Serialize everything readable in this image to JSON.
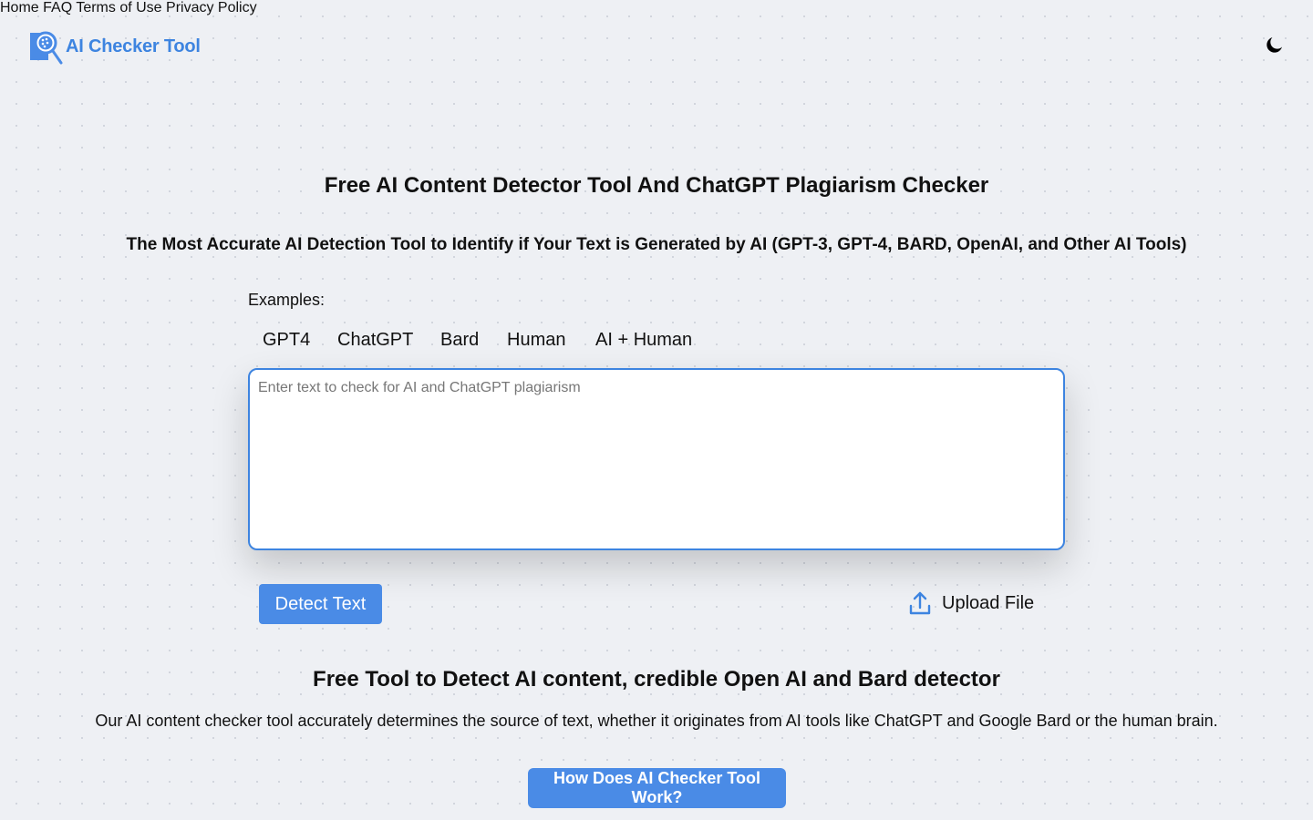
{
  "header": {
    "brand": "AI Checker Tool",
    "nav": [
      "Home",
      "FAQ",
      "Terms of Use",
      "Privacy Policy"
    ],
    "theme_toggle_icon": "moon-icon"
  },
  "hero": {
    "title": "Free AI Content Detector Tool And ChatGPT Plagiarism Checker",
    "subtitle": "The Most Accurate AI Detection Tool to Identify if Your Text is Generated by AI (GPT-3, GPT-4, BARD, OpenAI, and Other AI Tools)"
  },
  "examples": {
    "label": "Examples:",
    "items": [
      "GPT4",
      "ChatGPT",
      "Bard",
      "Human",
      "AI + Human"
    ]
  },
  "input": {
    "placeholder": "Enter text to check for AI and ChatGPT plagiarism",
    "value": ""
  },
  "actions": {
    "detect": "Detect Text",
    "upload": "Upload File",
    "upload_icon": "upload-icon"
  },
  "info": {
    "heading": "Free Tool to Detect AI content, credible Open AI and Bard detector",
    "description": "Our AI content checker tool accurately determines the source of text, whether it originates from AI tools like ChatGPT and Google Bard or the human brain.",
    "how_button": "How Does AI Checker Tool Work?"
  },
  "colors": {
    "accent": "#3d84e0",
    "button": "#4a8be6",
    "background": "#eef0f4"
  }
}
